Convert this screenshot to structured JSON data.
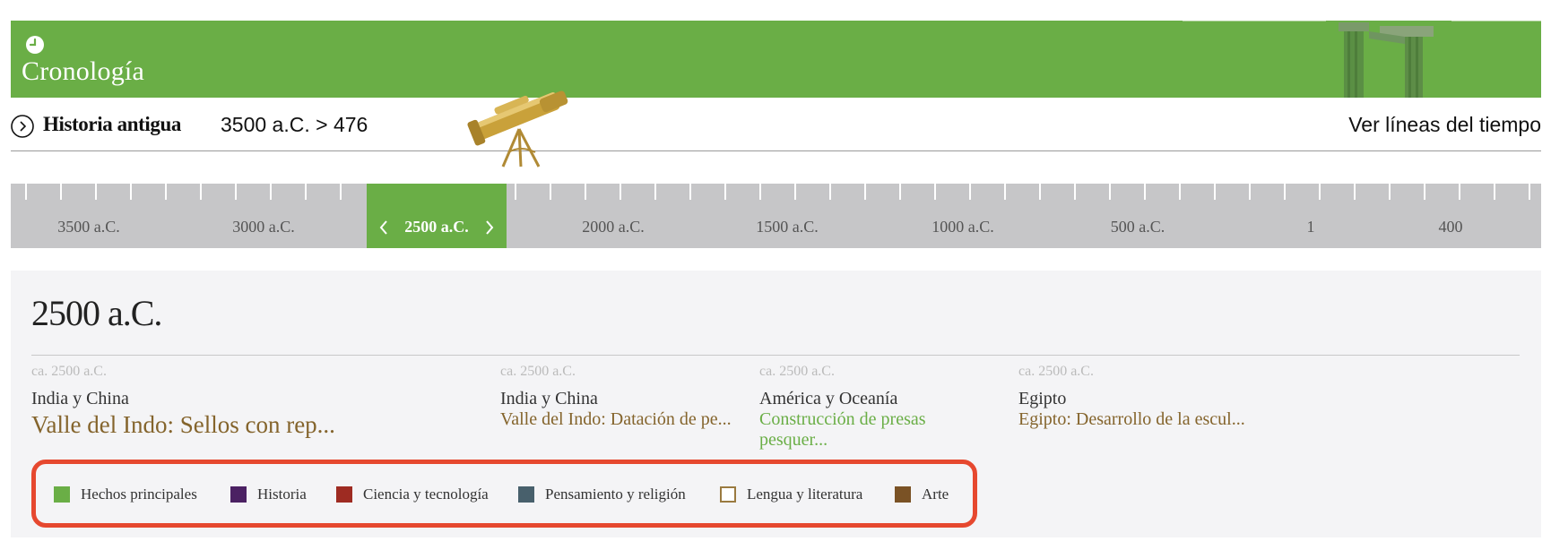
{
  "banner": {
    "title": "Cronología"
  },
  "header": {
    "section_name": "Historia antigua",
    "range": "3500 a.C. > 476",
    "timelines_link": "Ver líneas del tiempo"
  },
  "ruler": {
    "labels": [
      "3500 a.C.",
      "3000 a.C.",
      "2000 a.C.",
      "1500 a.C.",
      "1000 a.C.",
      "500 a.C.",
      "1",
      "400"
    ],
    "active_label": "2500 a.C."
  },
  "panel": {
    "year": "2500 a.C.",
    "events": [
      {
        "date": "ca. 2500 a.C.",
        "region": "India y China",
        "title": "Valle del Indo: Sellos con rep...",
        "color": "#84642c"
      },
      {
        "date": "ca. 2500 a.C.",
        "region": "India y China",
        "title": "Valle del Indo: Datación de pe...",
        "color": "#84642c"
      },
      {
        "date": "ca. 2500 a.C.",
        "region": "América y Oceanía",
        "title": "Construcción de presas pesquer...",
        "color": "#6aae46"
      },
      {
        "date": "ca. 2500 a.C.",
        "region": "Egipto",
        "title": "Egipto: Desarrollo de la escul...",
        "color": "#84642c"
      }
    ]
  },
  "legend": [
    {
      "label": "Hechos principales",
      "color": "#6aae46"
    },
    {
      "label": "Historia",
      "color": "#4b2163"
    },
    {
      "label": "Ciencia y tecnología",
      "color": "#9e2b22"
    },
    {
      "label": "Pensamiento y religión",
      "color": "#48606c"
    },
    {
      "label": "Lengua y literatura",
      "color": "#ffffff"
    },
    {
      "label": "Arte",
      "color": "#7a5225"
    }
  ],
  "icons": [
    "clock-icon",
    "ruins-image",
    "circle-arrow-right-icon",
    "telescope-image",
    "chevron-left-icon",
    "chevron-right-icon"
  ]
}
